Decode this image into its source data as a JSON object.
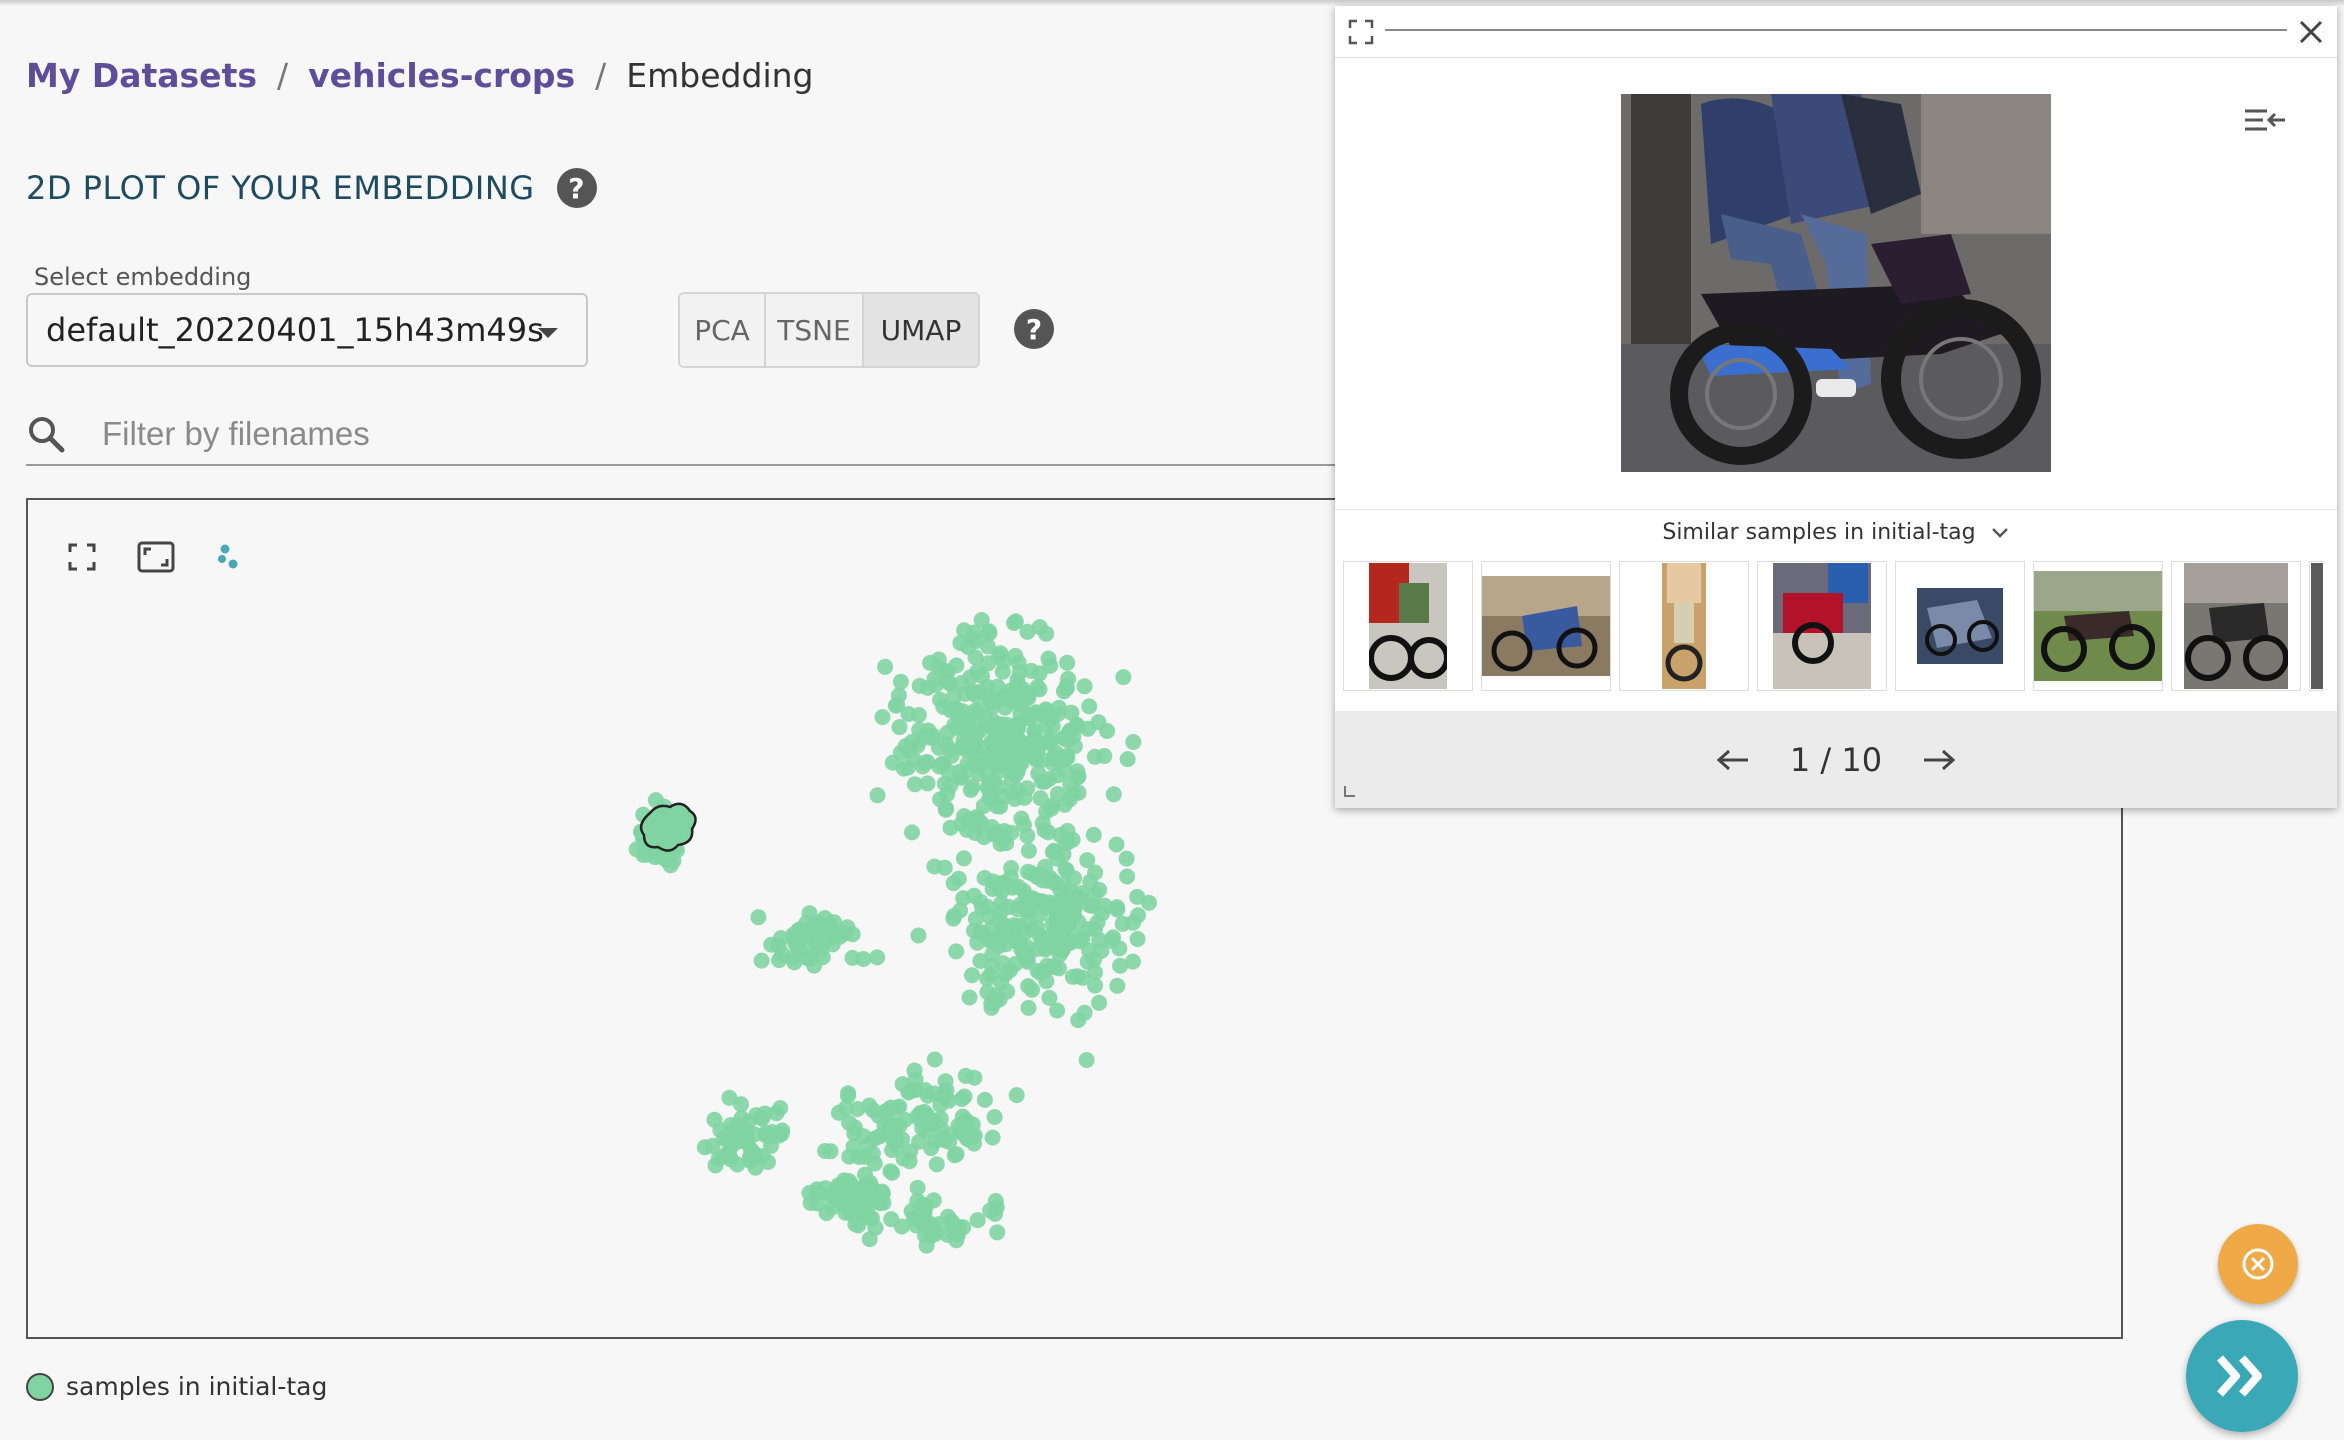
{
  "breadcrumb": {
    "items": [
      "My Datasets",
      "vehicles-crops"
    ],
    "separator": "/",
    "current": "Embedding"
  },
  "section": {
    "title": "2D PLOT OF YOUR EMBEDDING",
    "help": "?"
  },
  "embedding_select": {
    "label": "Select embedding",
    "value": "default_20220401_15h43m49s"
  },
  "algorithms": {
    "options": [
      "PCA",
      "TSNE",
      "UMAP"
    ],
    "selected": "UMAP",
    "help": "?"
  },
  "filter": {
    "placeholder": "Filter by filenames",
    "value": ""
  },
  "plot": {
    "tools": [
      "fullscreen-icon",
      "fit-view-icon",
      "point-size-icon"
    ],
    "point_color": "#7fd4a2",
    "selection_stroke": "#222222"
  },
  "legend": {
    "label": "samples in initial-tag",
    "color": "#7fd4a2"
  },
  "preview": {
    "similar_label": "Similar samples in initial-tag",
    "page": "1 / 10",
    "thumbnails": [
      "thumb-1",
      "thumb-2",
      "thumb-3",
      "thumb-4",
      "thumb-5",
      "thumb-6",
      "thumb-7",
      "thumb-8"
    ]
  },
  "colors": {
    "link": "#5c4e98",
    "title": "#1e4b60",
    "fab_clear": "#f0a947",
    "fab_next": "#3ba8b8"
  }
}
